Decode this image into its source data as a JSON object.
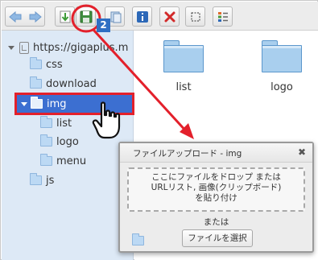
{
  "toolbar": {
    "buttons": [
      "back",
      "forward",
      "download",
      "save",
      "copy",
      "info",
      "delete",
      "select-all",
      "view-list"
    ]
  },
  "tree": {
    "root": "https://gigaplus.m",
    "items": [
      {
        "label": "css",
        "level": 1
      },
      {
        "label": "download",
        "level": 1
      },
      {
        "label": "img",
        "level": 1,
        "selected": true,
        "expanded": true
      },
      {
        "label": "list",
        "level": 2
      },
      {
        "label": "logo",
        "level": 2
      },
      {
        "label": "menu",
        "level": 2
      },
      {
        "label": "js",
        "level": 1
      }
    ]
  },
  "main": {
    "folders": [
      "list",
      "logo"
    ]
  },
  "dialog": {
    "title": "ファイルアップロード - img",
    "close": "✖",
    "drop_line1": "ここにファイルをドロップ または",
    "drop_line2": "URLリスト, 画像(クリップボード)",
    "drop_line3": "を貼り付け",
    "or": "または",
    "choose_button": "ファイルを選択"
  },
  "annotation": {
    "step_badge": "2",
    "highlight_color": "#e3202b",
    "badge_color": "#2f6fc3"
  }
}
